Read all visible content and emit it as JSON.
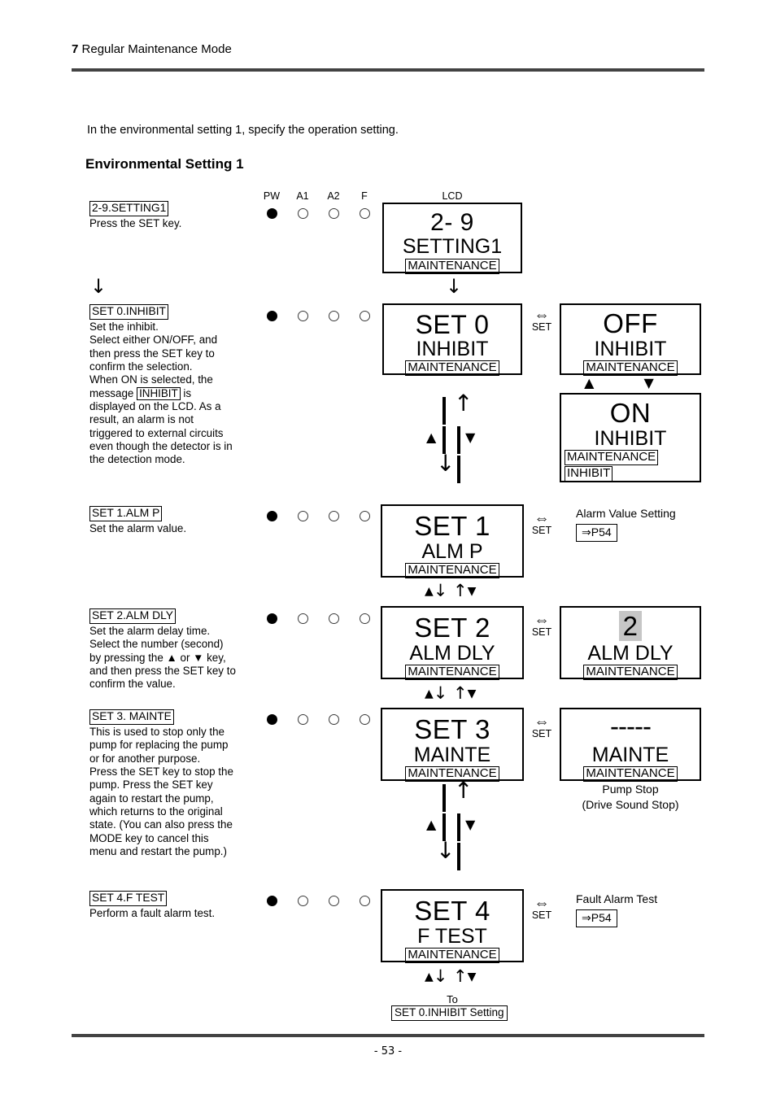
{
  "header": {
    "chapter_number": "7",
    "chapter_title": "Regular Maintenance Mode"
  },
  "footer": {
    "page_number": "- 53 -"
  },
  "intro": "In the environmental setting 1, specify the operation setting.",
  "section_title": "Environmental Setting 1",
  "columns": {
    "pw": "PW",
    "a1": "A1",
    "a2": "A2",
    "f": "F",
    "lcd": "LCD"
  },
  "set_link": {
    "symbol": "⇔",
    "label": "SET"
  },
  "nav": {
    "short": "▲↓ ↑▼",
    "to_label": "To",
    "to_target": "SET 0.INHIBIT Setting"
  },
  "steps": [
    {
      "tag": "2-9.SETTING1",
      "body": "Press the SET key.",
      "leds": [
        "on",
        "off",
        "off",
        "off"
      ],
      "lcd": {
        "line1": "2- 9",
        "line2": "SETTING1",
        "line3": "MAINTENANCE"
      }
    },
    {
      "tag": "SET 0.INHIBIT",
      "body_parts": [
        "Set the inhibit.",
        "Select either ON/OFF, and",
        "then press the SET key to",
        "confirm the selection.",
        "When ON is selected, the",
        "message |INHIBIT| is",
        "displayed on the LCD. As a",
        "result, an alarm is not",
        "triggered to external circuits",
        "even though the detector is in",
        "the detection mode."
      ],
      "boxed_word": "INHIBIT",
      "leds": [
        "on",
        "off",
        "off",
        "off"
      ],
      "lcd": {
        "line1": "SET 0",
        "line2": "INHIBIT",
        "line3": "MAINTENANCE"
      },
      "value_lcd_a": {
        "line1": "OFF",
        "line2": "INHIBIT",
        "line3": "MAINTENANCE"
      },
      "value_lcd_b": {
        "line1": "ON",
        "line2": "INHIBIT",
        "line3": "MAINTENANCE",
        "line4": "INHIBIT"
      },
      "toggle_arrows": "▲      ▼"
    },
    {
      "tag": "SET 1.ALM P",
      "body": "Set the alarm value.",
      "leds": [
        "on",
        "off",
        "off",
        "off"
      ],
      "lcd": {
        "line1": "SET 1",
        "line2": "ALM P",
        "line3": "MAINTENANCE"
      },
      "annotation_title": "Alarm Value Setting",
      "annotation_ref": "⇒P54"
    },
    {
      "tag": "SET 2.ALM DLY",
      "body_parts": [
        "Set the alarm delay time.",
        "Select the number (second)",
        "by pressing the ▲ or ▼ key,",
        "and then press the SET key to",
        "confirm the value."
      ],
      "leds": [
        "on",
        "off",
        "off",
        "off"
      ],
      "lcd": {
        "line1": "SET 2",
        "line2": "ALM DLY",
        "line3": "MAINTENANCE"
      },
      "value_lcd_a": {
        "line1": "2",
        "line1_highlighted": true,
        "line2": "ALM DLY",
        "line3": "MAINTENANCE"
      }
    },
    {
      "tag": "SET 3. MAINTE",
      "body_parts": [
        "This is used to stop only the",
        "pump for replacing the pump",
        "or for another purpose.",
        "Press the SET key to stop the",
        "pump. Press the SET key",
        "again to restart the pump,",
        "which returns to the original",
        "state. (You can also press the",
        "MODE key to cancel this",
        "menu and restart the pump.)"
      ],
      "leds": [
        "on",
        "off",
        "off",
        "off"
      ],
      "lcd": {
        "line1": "SET 3",
        "line2": "MAINTE",
        "line3": "MAINTENANCE"
      },
      "value_lcd_a": {
        "line1": "-----",
        "line2": "MAINTE",
        "line3": "MAINTENANCE"
      },
      "annotation_line1": "Pump Stop",
      "annotation_line2": "(Drive Sound Stop)"
    },
    {
      "tag": "SET 4.F TEST",
      "body": "Perform a fault alarm test.",
      "leds": [
        "on",
        "off",
        "off",
        "off"
      ],
      "lcd": {
        "line1": "SET 4",
        "line2": "F TEST",
        "line3": "MAINTENANCE"
      },
      "annotation_title": "Fault Alarm Test",
      "annotation_ref": "⇒P54"
    }
  ]
}
